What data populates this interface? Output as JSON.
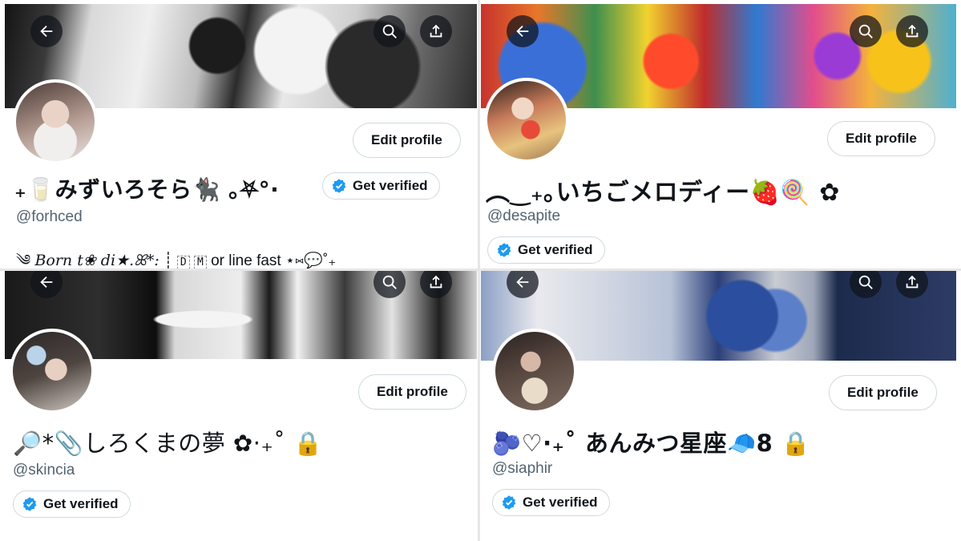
{
  "profiles": [
    {
      "display_name": "₊🥛みずいろそら🐈‍⬛ ｡⛧°·",
      "handle": "@forhced",
      "edit_label": "Edit profile",
      "verified_label": "Get verified",
      "bio": {
        "prefix": "༄",
        "styled": "Born t❀ di★.ꕤ*:",
        "sep": "┊",
        "box1": "D",
        "box2": "M",
        "text": "or line fast ⋆⑅💬˚₊"
      }
    },
    {
      "display_name": "︵‿₊｡いちごメロディー🍓🍭 ✿",
      "handle": "@desapite",
      "edit_label": "Edit profile",
      "verified_label": "Get verified"
    },
    {
      "display_name": "🔎*📎しろくまの夢 ✿·₊˚ 🔒",
      "handle": "@skincia",
      "edit_label": "Edit profile",
      "verified_label": "Get verified"
    },
    {
      "display_name": "🫐♡·₊˚ あんみつ星座🧢8 🔒",
      "handle": "@siaphir",
      "edit_label": "Edit profile",
      "verified_label": "Get verified"
    }
  ],
  "icons": {
    "back": "arrow-left-icon",
    "search": "search-icon",
    "share": "share-icon",
    "verified": "verified-badge-icon"
  },
  "colors": {
    "verified_blue": "#1d9bf0",
    "text_primary": "#0f1419",
    "text_secondary": "#536471",
    "border": "#cfd9de"
  }
}
